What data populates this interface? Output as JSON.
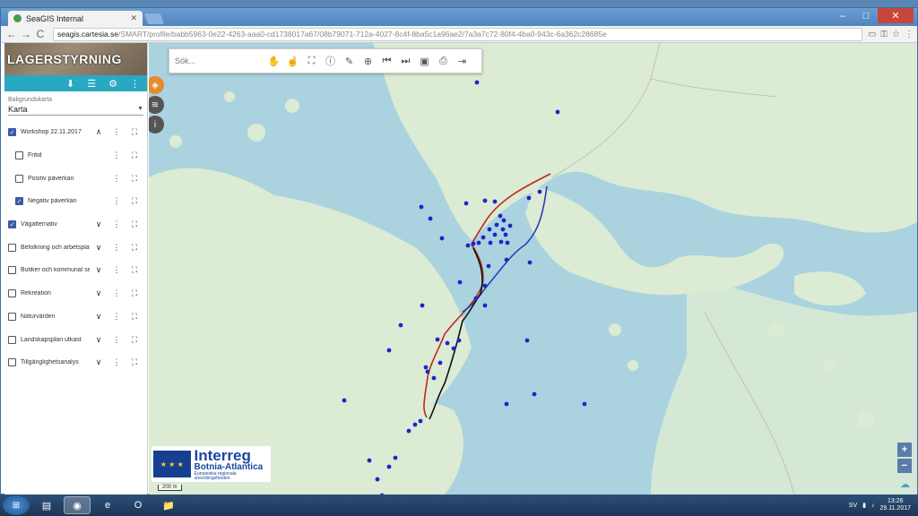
{
  "browser": {
    "tab_title": "SeaGIS Internal",
    "url_host": "seagis.cartesia.se",
    "url_path": "/SMART/profile/babb5963-0e22-4263-aaa0-cd1738017a67/08b79071-712a-4027-8c4f-8ba5c1a96ae2/7a3a7c72-80f4-4ba0-943c-6a362c28685e",
    "nav": {
      "back": "←",
      "forward": "→",
      "reload": "C"
    },
    "window_controls": {
      "minimize": "–",
      "maximize": "□",
      "close": "✕"
    }
  },
  "sidebar": {
    "banner_title": "LAGERSTYRNING",
    "toolbar_icons": [
      "download-icon",
      "list-icon",
      "gear-icon",
      "more-icon"
    ],
    "toolbar_glyphs": {
      "download": "⬇",
      "list": "☰",
      "gear": "⚙",
      "more": "⋮"
    },
    "basemap": {
      "label": "Bakgrundskarta",
      "value": "Karta",
      "arrow": "▼"
    },
    "layers": [
      {
        "name": "Workshop 22.11.2017",
        "checked": true,
        "sub": false,
        "chevron": "∧"
      },
      {
        "name": "Fritid",
        "checked": false,
        "sub": true,
        "chevron": ""
      },
      {
        "name": "Positiv påverkan",
        "checked": false,
        "sub": true,
        "chevron": ""
      },
      {
        "name": "Negativ påverkan",
        "checked": true,
        "sub": true,
        "chevron": ""
      },
      {
        "name": "Vägalternativ",
        "checked": true,
        "sub": false,
        "chevron": "∨"
      },
      {
        "name": "Befolkning och arbetsplatser",
        "checked": false,
        "sub": false,
        "chevron": "∨"
      },
      {
        "name": "Butiker och kommunal service",
        "checked": false,
        "sub": false,
        "chevron": "∨"
      },
      {
        "name": "Rekreation",
        "checked": false,
        "sub": false,
        "chevron": "∨"
      },
      {
        "name": "Naturvärden",
        "checked": false,
        "sub": false,
        "chevron": "∨"
      },
      {
        "name": "Landskapsplan utkast",
        "checked": false,
        "sub": false,
        "chevron": "∨"
      },
      {
        "name": "Tillgänglighetsanalys",
        "checked": false,
        "sub": false,
        "chevron": "∨"
      }
    ],
    "check_glyph": "✓",
    "dots_glyph": "⋮",
    "expand_glyph": "⛶"
  },
  "map": {
    "search_placeholder": "Sök...",
    "tool_glyphs": [
      "✋",
      "☝",
      "⛶",
      "ⓘ",
      "✎",
      "⊕",
      "⏮",
      "⏭",
      "▣",
      "⎙",
      "⇥"
    ],
    "tool_names": [
      "pan-icon",
      "select-icon",
      "fullscreen-icon",
      "info-icon",
      "draw-icon",
      "measure-icon",
      "prev-extent-icon",
      "next-extent-icon",
      "image-icon",
      "print-icon",
      "export-icon"
    ],
    "side_glyphs": [
      "◈",
      "≋",
      "i"
    ],
    "zoom_in": "+",
    "zoom_out": "−",
    "scale_label": "200 m",
    "logo": {
      "title": "Interreg",
      "subtitle": "Botnia-Atlantica",
      "tagline": "Europeiska regionala utvecklingsfonden",
      "flag_text": "EUROPEISKA UNIONEN"
    },
    "colors": {
      "water": "#aad3df",
      "land": "#dcebd3",
      "route_red": "#c0261f",
      "route_blue": "#2b3fb8",
      "route_black": "#111111",
      "point": "#1f25c9"
    }
  },
  "taskbar": {
    "apps": [
      "explorer",
      "chrome",
      "ie",
      "opera",
      "folder"
    ],
    "app_glyphs": [
      "▤",
      "◉",
      "e",
      "O",
      "📁"
    ],
    "language": "SV",
    "time": "13:26",
    "date": "29.11.2017"
  }
}
